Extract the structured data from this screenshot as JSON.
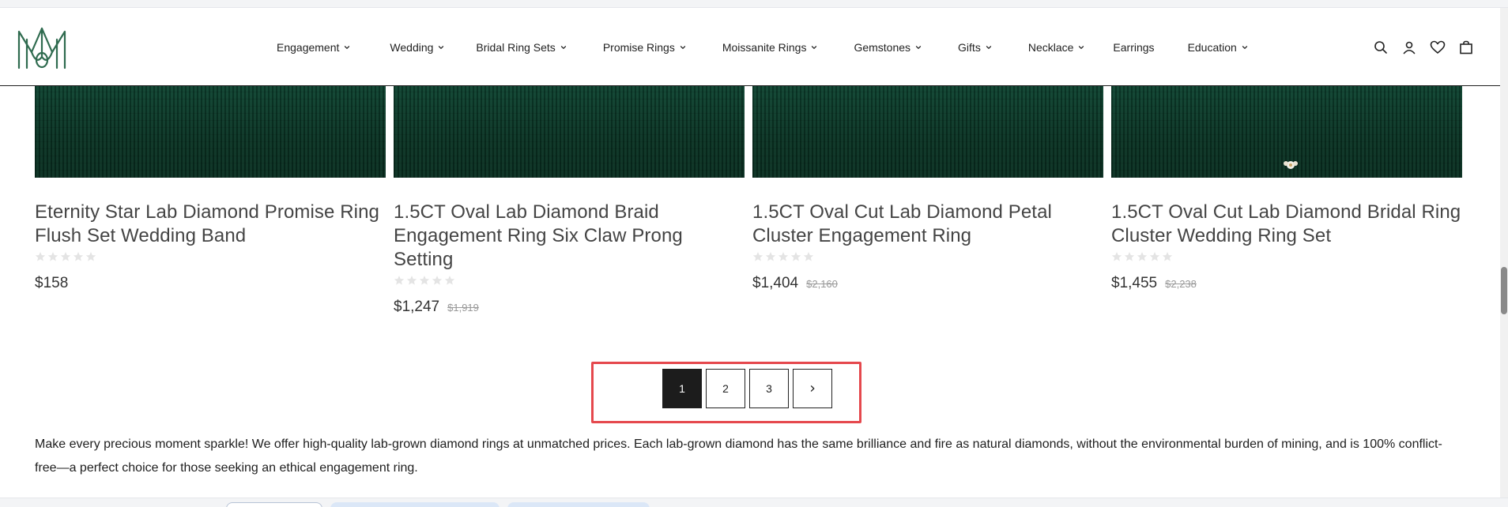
{
  "brand": {
    "logo_alt": "MM monogram logo"
  },
  "nav": {
    "items": [
      {
        "label": "Engagement",
        "dropdown": true
      },
      {
        "label": "Wedding",
        "dropdown": true
      },
      {
        "label": "Bridal Ring Sets",
        "dropdown": true
      },
      {
        "label": "Promise Rings",
        "dropdown": true
      },
      {
        "label": "Moissanite Rings",
        "dropdown": true
      },
      {
        "label": "Gemstones",
        "dropdown": true
      },
      {
        "label": "Gifts",
        "dropdown": true
      },
      {
        "label": "Necklace",
        "dropdown": true
      },
      {
        "label": "Earrings",
        "dropdown": false
      },
      {
        "label": "Education",
        "dropdown": true
      }
    ]
  },
  "header_icons": [
    "search-icon",
    "account-icon",
    "wishlist-heart-icon",
    "cart-bag-icon"
  ],
  "products": [
    {
      "title": "Eternity Star Lab Diamond Promise Ring Flush Set Wedding Band",
      "rating": 0,
      "price": "$158",
      "old_price": ""
    },
    {
      "title": "1.5CT Oval Lab Diamond Braid Engagement Ring Six Claw Prong Setting",
      "rating": 0,
      "price": "$1,247",
      "old_price": "$1,919"
    },
    {
      "title": "1.5CT Oval Cut Lab Diamond Petal Cluster Engagement Ring",
      "rating": 0,
      "price": "$1,404",
      "old_price": "$2,160"
    },
    {
      "title": "1.5CT Oval Cut Lab Diamond Bridal Ring Cluster Wedding Ring Set",
      "rating": 0,
      "price": "$1,455",
      "old_price": "$2,238"
    }
  ],
  "pagination": {
    "pages": [
      "1",
      "2",
      "3"
    ],
    "current": "1",
    "next_icon": "chevron-right-icon"
  },
  "description": "Make every precious moment sparkle! We offer high-quality lab-grown diamond rings at unmatched prices. Each lab-grown diamond has the same brilliance and fire as natural diamonds, without the environmental burden of mining, and is 100% conflict-free—a perfect choice for those seeking an ethical engagement ring.",
  "colors": {
    "accent_black": "#1c1c1c",
    "highlight_red": "#e5484d",
    "velvet_green": "#0c3b2b",
    "logo_green": "#2f6b4f"
  }
}
